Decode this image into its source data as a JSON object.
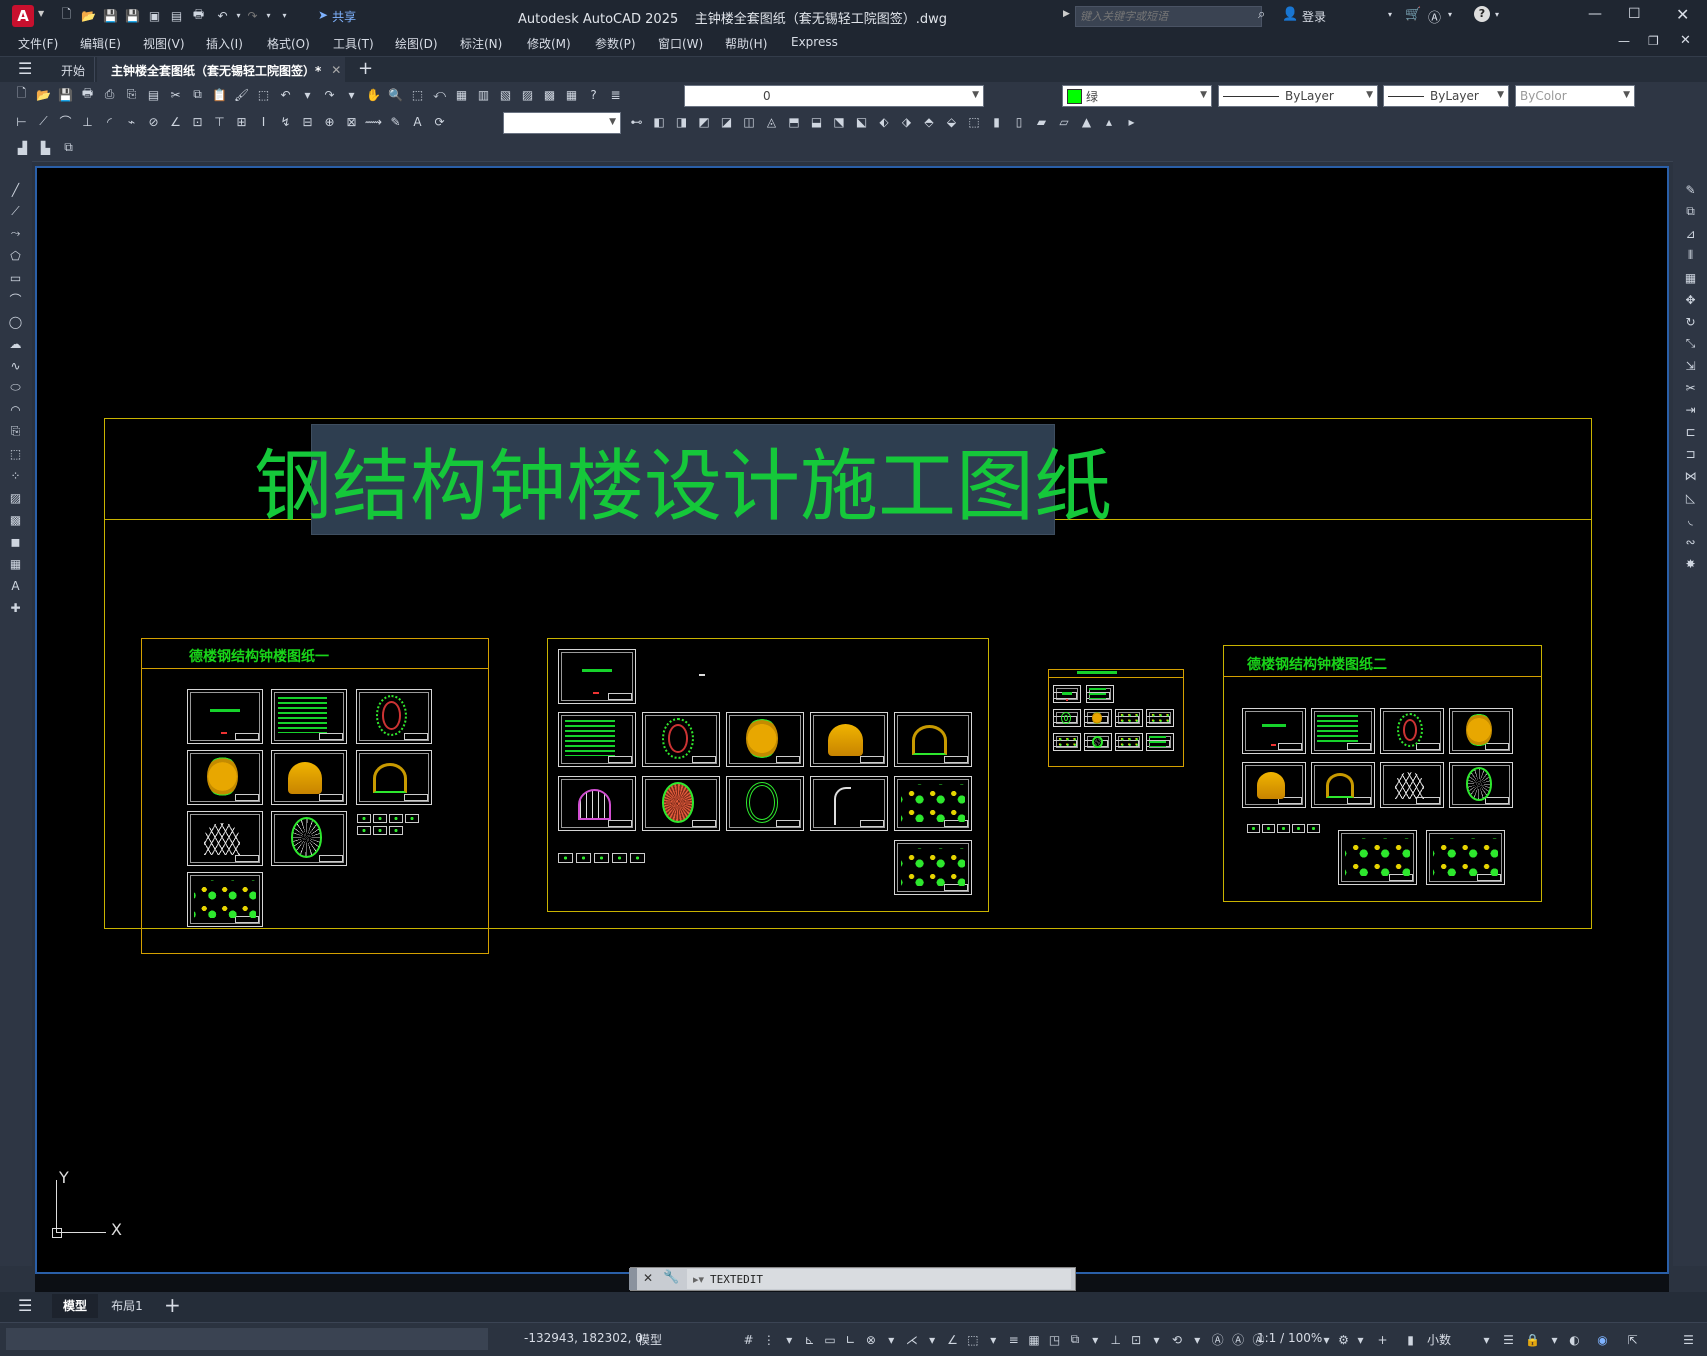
{
  "app": {
    "logo_letter": "A",
    "title": "Autodesk AutoCAD 2025",
    "document": "主钟楼全套图纸（套无锡轻工院图签）.dwg",
    "share_label": "共享",
    "search_placeholder": "键入关键字或短语",
    "signin_label": "登录"
  },
  "menu": [
    "文件(F)",
    "编辑(E)",
    "视图(V)",
    "插入(I)",
    "格式(O)",
    "工具(T)",
    "绘图(D)",
    "标注(N)",
    "修改(M)",
    "参数(P)",
    "窗口(W)",
    "帮助(H)",
    "Express"
  ],
  "tabs": {
    "start": "开始",
    "active": "主钟楼全套图纸（套无锡轻工院图签）*"
  },
  "properties": {
    "layer": "0",
    "color": "绿",
    "linetype": "ByLayer",
    "lineweight": "ByLayer",
    "plotstyle": "ByColor",
    "color_hex": "#00ff00"
  },
  "drawing": {
    "main_title": "钢结构钟楼设计施工图纸",
    "group1_title": "德楼钢结构钟楼图纸一",
    "group2_title": "德楼钢结构钟楼图纸二",
    "ucs_y": "Y",
    "ucs_x": "X"
  },
  "command": {
    "current": "TEXTEDIT"
  },
  "layout_tabs": {
    "model": "模型",
    "layout1": "布局1"
  },
  "status": {
    "coords": "-132943, 182302, 0",
    "mode": "模型",
    "scale": "1:1 / 100%",
    "units": "小数"
  },
  "colors": {
    "accent_red": "#c8102e",
    "frame_yellow": "#c9b300",
    "text_green": "#19d419",
    "viewport_border": "#2a5fa8"
  }
}
